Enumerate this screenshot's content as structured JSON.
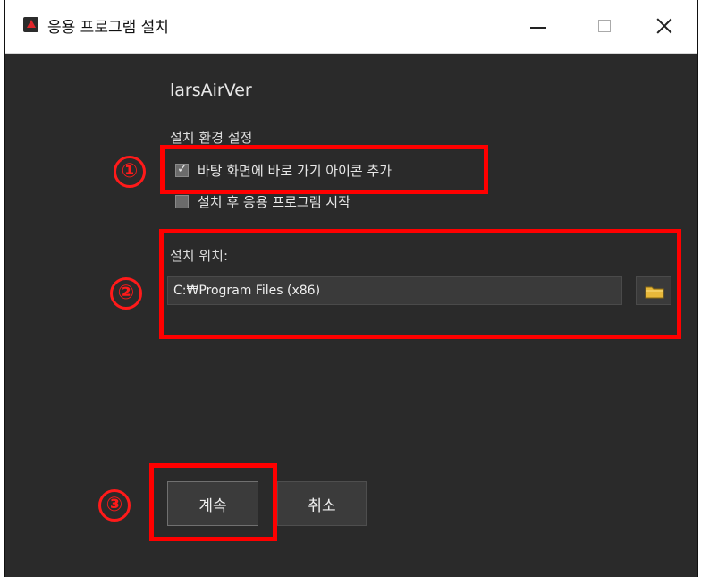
{
  "window": {
    "title": "응용 프로그램 설치",
    "controls": {
      "minimize": "minimize",
      "maximize": "maximize",
      "close": "close"
    }
  },
  "installer": {
    "app_name": "larsAirVer",
    "settings_heading": "설치 환경 설정",
    "options": [
      {
        "label": "바탕 화면에 바로 가기 아이콘 추가",
        "checked": true
      },
      {
        "label": "설치 후 응용 프로그램 시작",
        "checked": false
      }
    ],
    "location_label": "설치 위치:",
    "location_value": "C:₩Program Files (x86)",
    "continue_label": "계속",
    "cancel_label": "취소"
  },
  "annotations": {
    "markers": [
      "①",
      "②",
      "③"
    ],
    "color": "#ff0000"
  },
  "icons": {
    "app": "adobe-air-icon",
    "browse": "folder-icon",
    "check": "checkmark-icon"
  },
  "colors": {
    "window_bg": "#2a2a2a",
    "titlebar_bg": "#ffffff",
    "highlight": "#ff0000",
    "text": "#e8e8e8"
  }
}
